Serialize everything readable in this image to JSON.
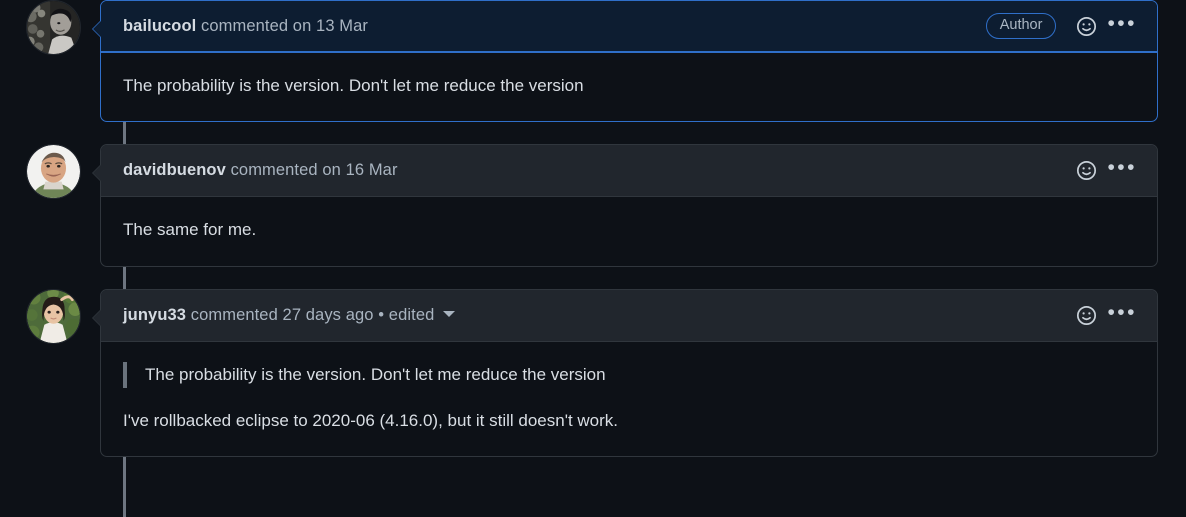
{
  "theme": {
    "page_bg": "#0d1117",
    "border": "#30363d",
    "header_bg": "#21262d",
    "accent": "#2f6fc9",
    "highlight_header_bg": "#0d1d31",
    "thread_line": "#6e7681",
    "text": "#d9dee4",
    "muted_text": "#a9b4c0"
  },
  "comments": [
    {
      "author": "bailucool",
      "action": "commented on",
      "timestamp": "13 Mar",
      "edited": "",
      "badge": "Author",
      "highlighted": true,
      "avatar_name": "avatar-bailucool",
      "reaction_icon": "smiley-icon",
      "menu_icon": "kebab-menu-icon",
      "quote": "",
      "paragraphs": [
        "The probability is the version. Don't let me reduce the version"
      ]
    },
    {
      "author": "davidbuenov",
      "action": "commented on",
      "timestamp": "16 Mar",
      "edited": "",
      "badge": "",
      "highlighted": false,
      "avatar_name": "avatar-davidbuenov",
      "reaction_icon": "smiley-icon",
      "menu_icon": "kebab-menu-icon",
      "quote": "",
      "paragraphs": [
        "The same for me."
      ]
    },
    {
      "author": "junyu33",
      "action": "commented",
      "timestamp": "27 days ago",
      "edited": "• edited",
      "badge": "",
      "highlighted": false,
      "avatar_name": "avatar-junyu33",
      "reaction_icon": "smiley-icon",
      "menu_icon": "kebab-menu-icon",
      "quote": "The probability is the version. Don't let me reduce the version",
      "paragraphs": [
        "I've rollbacked eclipse to 2020-06 (4.16.0), but it still doesn't work."
      ]
    }
  ],
  "icons": {
    "kebab": "•••"
  }
}
